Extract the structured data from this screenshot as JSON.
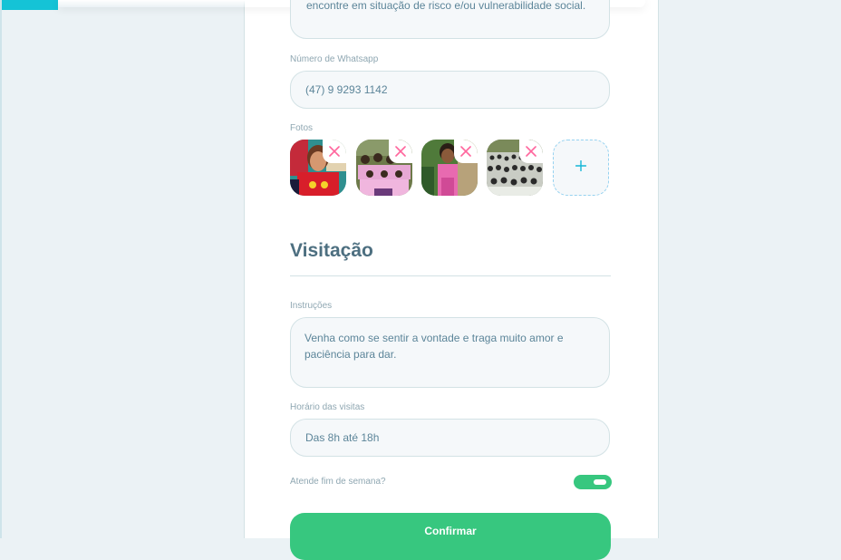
{
  "about": {
    "text": "encontre em situação de risco e/ou vulnerabilidade social."
  },
  "whatsapp": {
    "label": "Número de Whatsapp",
    "value": "(47) 9 9293 1142"
  },
  "photos": {
    "label": "Fotos",
    "items": [
      {
        "alt": "photo-1"
      },
      {
        "alt": "photo-2"
      },
      {
        "alt": "photo-3"
      },
      {
        "alt": "photo-4"
      }
    ],
    "remove_icon": "×",
    "add_icon": "+"
  },
  "visitation": {
    "title": "Visitação",
    "instructions_label": "Instruções",
    "instructions_line1": "Venha como se sentir a vontade e traga muito amor e",
    "instructions_line2": "paciência para dar.",
    "hours_label": "Horário das visitas",
    "hours_value": "Das 8h até 18h",
    "weekend_label": "Atende fim de semana?",
    "weekend_open": true
  },
  "confirm_label": "Confirmar",
  "colors": {
    "accent": "#15c3d6",
    "success": "#37c77f",
    "remove": "#ff669d",
    "add": "#15b6d6"
  }
}
